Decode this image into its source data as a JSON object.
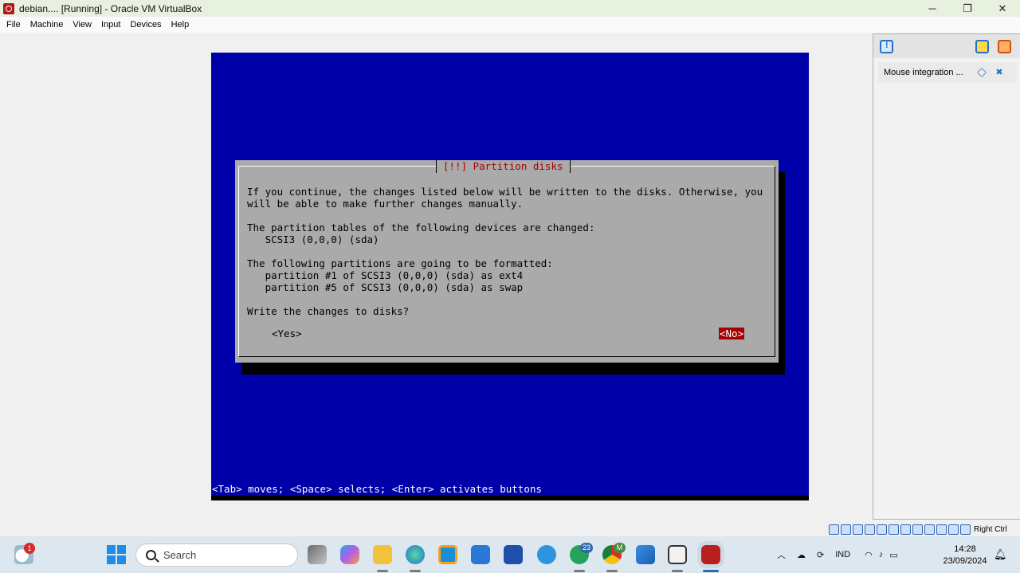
{
  "window": {
    "title": "debian.... [Running] - Oracle VM VirtualBox",
    "controls": {
      "minimize": "─",
      "restore": "❐",
      "close": "✕"
    }
  },
  "menu": [
    "File",
    "Machine",
    "View",
    "Input",
    "Devices",
    "Help"
  ],
  "installer": {
    "dialog_title": "[!!] Partition disks",
    "lines": [
      "If you continue, the changes listed below will be written to the disks. Otherwise, you",
      "will be able to make further changes manually.",
      "The partition tables of the following devices are changed:",
      "   SCSI3 (0,0,0) (sda)",
      "The following partitions are going to be formatted:",
      "   partition #1 of SCSI3 (0,0,0) (sda) as ext4",
      "   partition #5 of SCSI3 (0,0,0) (sda) as swap",
      "Write the changes to disks?"
    ],
    "yes_button": "<Yes>",
    "no_button": "<No>",
    "help_line": "<Tab> moves; <Space> selects; <Enter> activates buttons"
  },
  "notification_panel": {
    "item_text": "Mouse integration ..."
  },
  "statusbar": {
    "host_key": "Right Ctrl"
  },
  "taskbar": {
    "search_placeholder": "Search",
    "weather_badge": "1",
    "whatsapp_badge": "23",
    "chrome_badge": "M",
    "language": "IND",
    "time": "14:28",
    "date": "23/09/2024"
  },
  "colors": {
    "vm_background": "#0000a8",
    "dialog_bg": "#aaaaaa",
    "dialog_title": "#a80000",
    "selected_button": "#a80000"
  }
}
